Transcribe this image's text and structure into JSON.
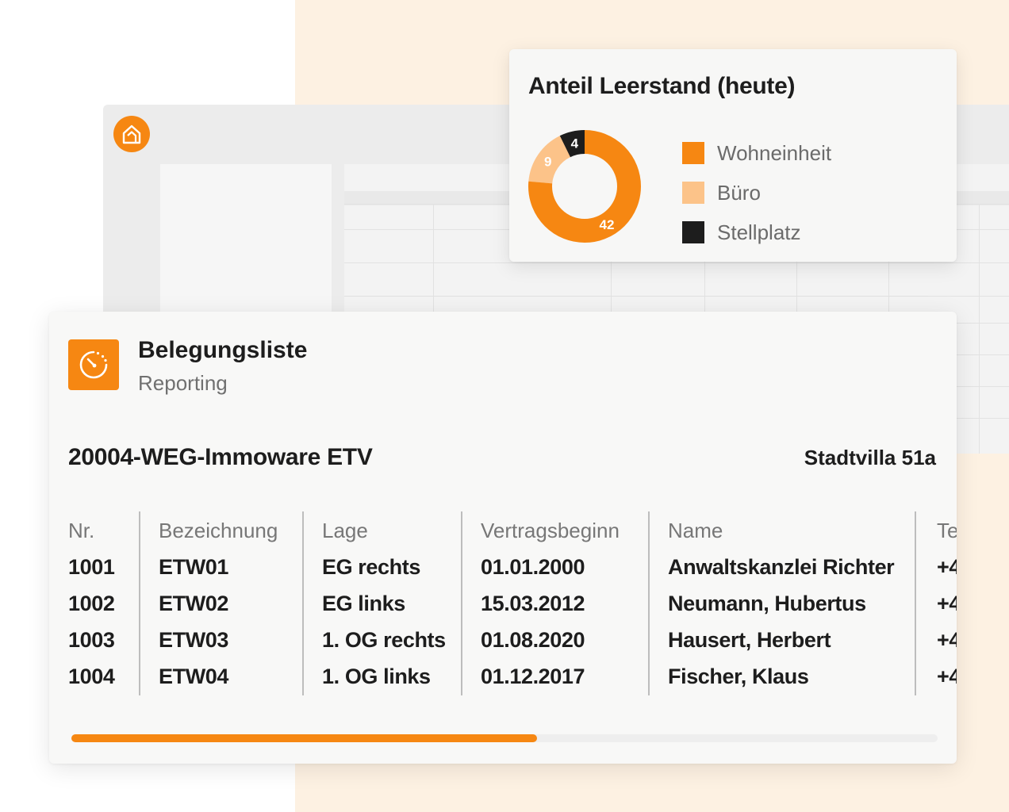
{
  "colors": {
    "accent": "#f68712",
    "accent_light": "#fcc389",
    "dark": "#1d1d1d",
    "muted": "#707070",
    "peach_background": "#fdf1e2"
  },
  "background_app": {
    "logo_icon": "house-icon"
  },
  "vacancy_card": {
    "title": "Anteil Leerstand (heute)",
    "legend": [
      {
        "label": "Wohneinheit",
        "color": "#f68712"
      },
      {
        "label": "Büro",
        "color": "#fcc389"
      },
      {
        "label": "Stellplatz",
        "color": "#1d1d1d"
      }
    ]
  },
  "chart_data": {
    "type": "pie",
    "donut": true,
    "title": "Anteil Leerstand (heute)",
    "categories": [
      "Wohneinheit",
      "Büro",
      "Stellplatz"
    ],
    "values": [
      42,
      9,
      4
    ],
    "colors": [
      "#f68712",
      "#fcc389",
      "#1d1d1d"
    ],
    "data_labels": [
      "42",
      "9",
      "4"
    ],
    "legend_position": "right"
  },
  "list_card": {
    "icon": "stopwatch-icon",
    "title": "Belegungsliste",
    "subtitle": "Reporting",
    "property": "20004-WEG-Immoware ETV",
    "building": "Stadtvilla 51a",
    "columns": [
      "Nr.",
      "Bezeichnung",
      "Lage",
      "Vertragsbeginn",
      "Name",
      "Te"
    ],
    "rows": [
      [
        "1001",
        "ETW01",
        "EG rechts",
        "01.01.2000",
        "Anwaltskanzlei Richter",
        "+4"
      ],
      [
        "1002",
        "ETW02",
        "EG links",
        "15.03.2012",
        "Neumann, Hubertus",
        "+4"
      ],
      [
        "1003",
        "ETW03",
        "1. OG rechts",
        "01.08.2020",
        "Hausert, Herbert",
        "+4"
      ],
      [
        "1004",
        "ETW04",
        "1. OG links",
        "01.12.2017",
        "Fischer, Klaus",
        "+4"
      ]
    ],
    "progress_fraction": 0.538
  }
}
